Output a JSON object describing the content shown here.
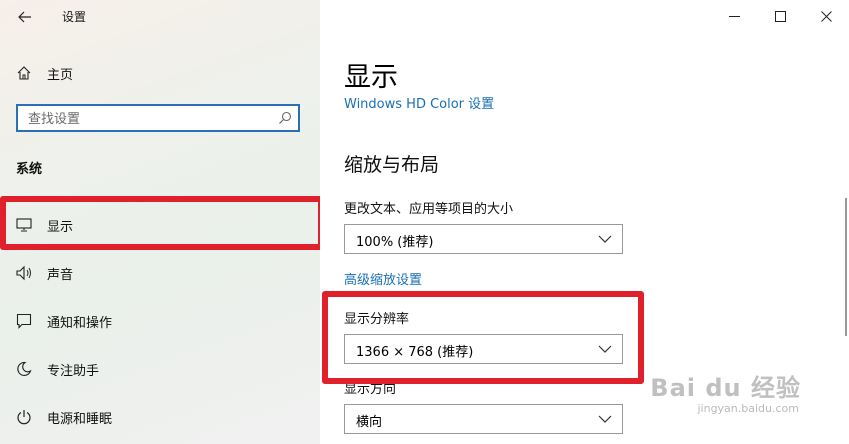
{
  "window": {
    "title": "设置",
    "back_icon": "back-arrow-icon",
    "controls": {
      "minimize": "minimize-icon",
      "maximize": "maximize-icon",
      "close": "close-icon"
    }
  },
  "sidebar": {
    "home_label": "主页",
    "search_placeholder": "查找设置",
    "section_label": "系统",
    "items": [
      {
        "label": "显示",
        "icon": "monitor-icon"
      },
      {
        "label": "声音",
        "icon": "speaker-icon"
      },
      {
        "label": "通知和操作",
        "icon": "notification-icon"
      },
      {
        "label": "专注助手",
        "icon": "moon-icon"
      },
      {
        "label": "电源和睡眠",
        "icon": "power-icon"
      }
    ]
  },
  "main": {
    "page_title": "显示",
    "hdr_link": "Windows HD Color 设置",
    "section_title": "缩放与布局",
    "scale_label": "更改文本、应用等项目的大小",
    "scale_value": "100% (推荐)",
    "advanced_link": "高级缩放设置",
    "resolution_label": "显示分辨率",
    "resolution_value": "1366 × 768 (推荐)",
    "orientation_label": "显示方向",
    "orientation_value": "横向"
  },
  "watermark": {
    "brand": "Bai du 经验",
    "url": "jingyan.baidu.com"
  },
  "colors": {
    "accent": "#1a6fb4",
    "highlight_box": "#e0202b",
    "search_border": "#2b6fb7"
  }
}
